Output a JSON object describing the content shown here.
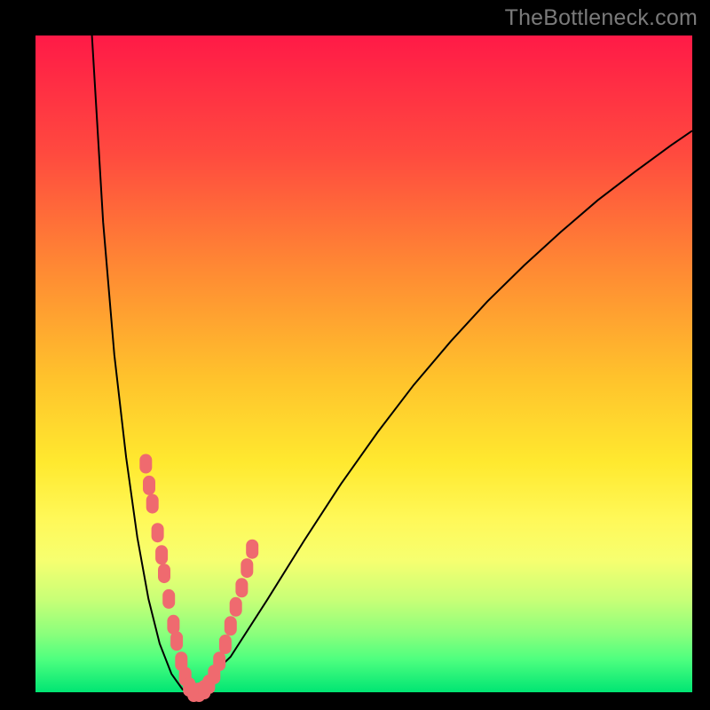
{
  "watermark": "TheBottleneck.com",
  "colors": {
    "gradient_top": "#ff1a47",
    "gradient_mid": "#ffe92f",
    "gradient_bottom": "#00e573",
    "curve": "#000000",
    "marker": "#ef6a6f",
    "frame": "#000000"
  },
  "chart_data": {
    "type": "line",
    "title": "",
    "xlabel": "",
    "ylabel": "",
    "xlim": [
      0,
      1
    ],
    "ylim": [
      0,
      1
    ],
    "note": "Axes are unlabeled in the source image; x and y normalized to plot box",
    "series": [
      {
        "name": "left-curve",
        "x": [
          0.086,
          0.103,
          0.12,
          0.138,
          0.155,
          0.172,
          0.189,
          0.207,
          0.224,
          0.241
        ],
        "y": [
          1.0,
          0.716,
          0.514,
          0.358,
          0.236,
          0.142,
          0.074,
          0.028,
          0.004,
          0.0
        ]
      },
      {
        "name": "right-curve",
        "x": [
          0.241,
          0.297,
          0.353,
          0.409,
          0.465,
          0.521,
          0.576,
          0.632,
          0.688,
          0.744,
          0.8,
          0.856,
          0.912,
          0.968,
          1.0
        ],
        "y": [
          0.0,
          0.054,
          0.141,
          0.231,
          0.317,
          0.396,
          0.468,
          0.534,
          0.595,
          0.65,
          0.701,
          0.749,
          0.792,
          0.833,
          0.855
        ]
      }
    ],
    "markers": [
      {
        "x": 0.168,
        "y": 0.348
      },
      {
        "x": 0.173,
        "y": 0.315
      },
      {
        "x": 0.178,
        "y": 0.287
      },
      {
        "x": 0.186,
        "y": 0.243
      },
      {
        "x": 0.192,
        "y": 0.209
      },
      {
        "x": 0.196,
        "y": 0.181
      },
      {
        "x": 0.203,
        "y": 0.142
      },
      {
        "x": 0.21,
        "y": 0.103
      },
      {
        "x": 0.215,
        "y": 0.078
      },
      {
        "x": 0.222,
        "y": 0.047
      },
      {
        "x": 0.228,
        "y": 0.024
      },
      {
        "x": 0.234,
        "y": 0.008
      },
      {
        "x": 0.241,
        "y": 0.0
      },
      {
        "x": 0.249,
        "y": 0.0
      },
      {
        "x": 0.257,
        "y": 0.004
      },
      {
        "x": 0.264,
        "y": 0.012
      },
      {
        "x": 0.272,
        "y": 0.027
      },
      {
        "x": 0.28,
        "y": 0.047
      },
      {
        "x": 0.289,
        "y": 0.073
      },
      {
        "x": 0.297,
        "y": 0.101
      },
      {
        "x": 0.305,
        "y": 0.13
      },
      {
        "x": 0.314,
        "y": 0.159
      },
      {
        "x": 0.322,
        "y": 0.189
      },
      {
        "x": 0.33,
        "y": 0.218
      }
    ]
  }
}
